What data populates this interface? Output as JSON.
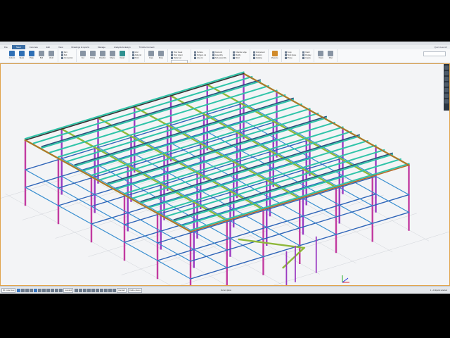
{
  "menu": {
    "items": [
      "File",
      "Steel",
      "Concrete",
      "Edit",
      "View",
      "Drawings & reports",
      "Manage",
      "Analysis & design",
      "Trimble Connect"
    ],
    "active_index": 1,
    "quick_search": "Quick Launch"
  },
  "ribbon": {
    "groups": [
      {
        "tools": [
          {
            "label": "Column",
            "icon": "column-icon",
            "color": "blue"
          },
          {
            "label": "Beam",
            "icon": "beam-icon",
            "color": "blue"
          },
          {
            "label": "Plate",
            "icon": "plate-icon",
            "color": "blue"
          },
          {
            "label": "Bolt",
            "icon": "bolt-icon",
            "color": "gray"
          },
          {
            "label": "Weld",
            "icon": "weld-icon",
            "color": "gray"
          }
        ]
      },
      {
        "small": [
          "Part",
          "Bolt",
          "Connection"
        ]
      },
      {
        "tools": [
          {
            "label": "Cut",
            "icon": "cut-icon",
            "color": "gray"
          },
          {
            "label": "Fitting",
            "icon": "fitting-icon",
            "color": "gray"
          },
          {
            "label": "Chamfer",
            "icon": "chamfer-icon",
            "color": "gray"
          },
          {
            "label": "Shape",
            "icon": "shape-icon",
            "color": "gray"
          },
          {
            "label": "Detail",
            "icon": "detail-icon",
            "color": "teal"
          }
        ]
      },
      {
        "small": [
          "Grid",
          "Add grid",
          "Point"
        ]
      },
      {
        "tools": [
          {
            "label": "Copy",
            "icon": "copy-icon",
            "color": "gray"
          },
          {
            "label": "Move",
            "icon": "move-icon",
            "color": "gray"
          }
        ]
      },
      {
        "small": [
          "Pour break",
          "Pour object",
          "Rebar set"
        ],
        "field": true
      },
      {
        "small": [
          "Surface",
          "Polygon cut",
          "Line cut"
        ]
      },
      {
        "small": [
          "Cast unit",
          "Assembly",
          "Sub-assembly"
        ]
      },
      {
        "small": [
          "Chamfer edge",
          "Modify",
          "Weld"
        ]
      },
      {
        "small": [
          "Component",
          "Custom",
          "Catalog"
        ]
      },
      {
        "tools": [
          {
            "label": "Measure",
            "icon": "measure-icon",
            "color": "orange"
          }
        ]
      },
      {
        "small": [
          "Snap",
          "Work plane",
          "Phase"
        ]
      },
      {
        "small": [
          "Clash",
          "Display",
          "Inquire"
        ]
      },
      {
        "tools": [
          {
            "label": "Views",
            "icon": "views-icon",
            "color": "gray"
          },
          {
            "label": "Filter",
            "icon": "filter-icon",
            "color": "gray"
          }
        ]
      }
    ]
  },
  "status": {
    "view_select": "3D model view",
    "selects": [
      "standard",
      "standard",
      "Outline planes"
    ],
    "current_plane": "Current plane",
    "selected_text": "1 + 0 objects selected"
  },
  "side_panel": {
    "buttons": [
      "properties-icon",
      "views-icon",
      "catalog-icon",
      "settings-icon",
      "help-icon",
      "search-icon",
      "layers-icon"
    ]
  },
  "colors": {
    "beam_cyan": "#2ec4a8",
    "beam_green": "#8fb83a",
    "beam_blue": "#2e64b8",
    "column_purple": "#9b3ac2",
    "column_magenta": "#c23aa0",
    "frame_orange": "#e0a24a"
  }
}
